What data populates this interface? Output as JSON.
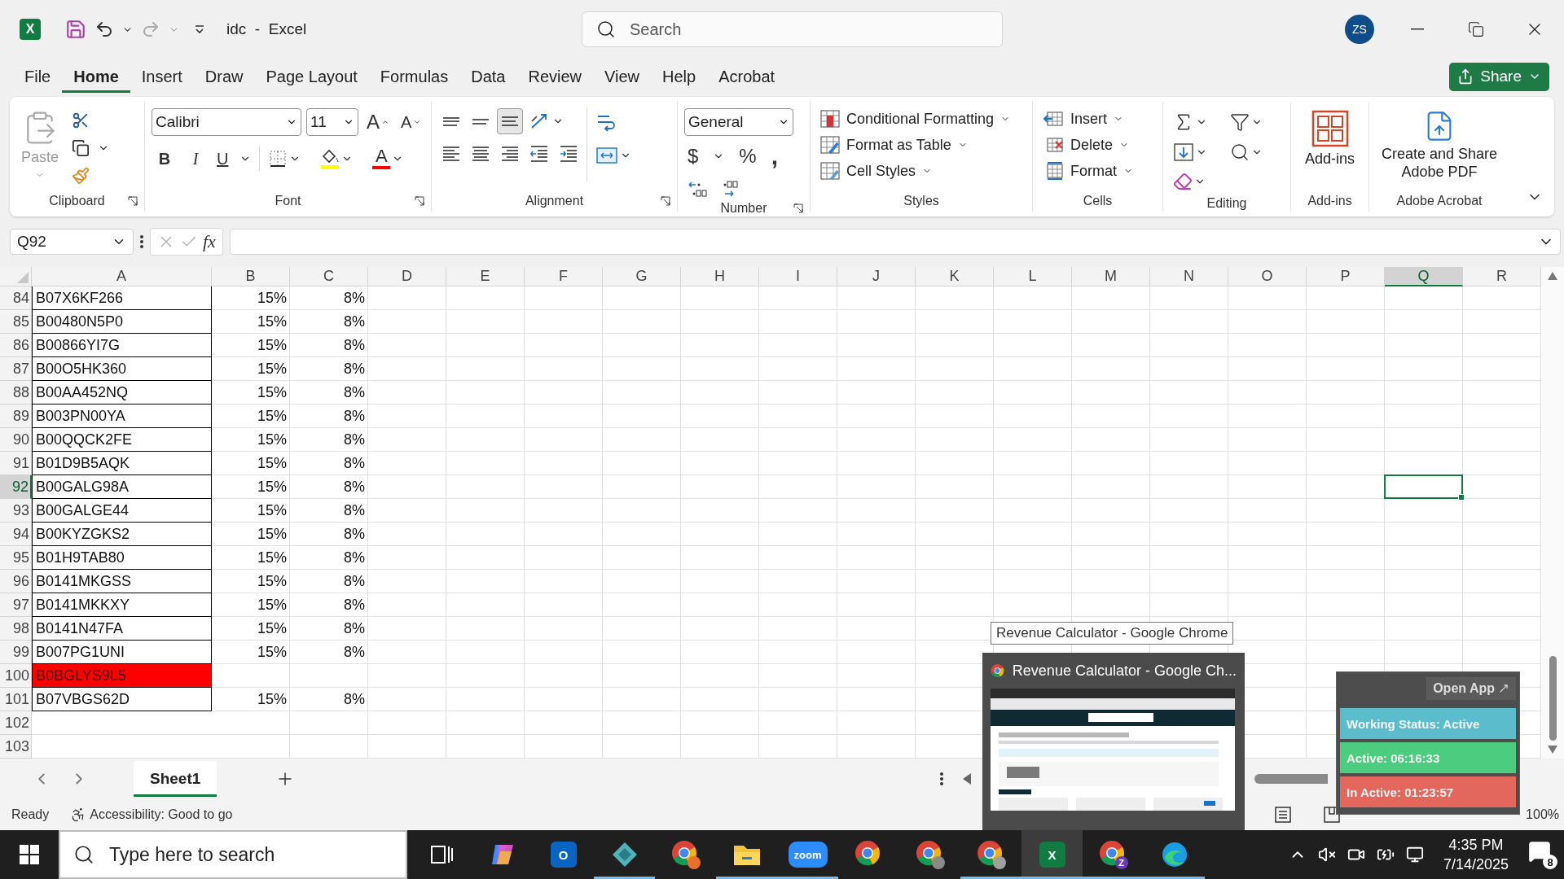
{
  "title_bar": {
    "logo": "X",
    "title": "idc  -  Excel",
    "search": {
      "placeholder": "Search"
    },
    "avatar": "ZS"
  },
  "ribbon_tabs": [
    {
      "label": "File",
      "selected": false
    },
    {
      "label": "Home",
      "selected": true
    },
    {
      "label": "Insert",
      "selected": false
    },
    {
      "label": "Draw",
      "selected": false
    },
    {
      "label": "Page Layout",
      "selected": false
    },
    {
      "label": "Formulas",
      "selected": false
    },
    {
      "label": "Data",
      "selected": false
    },
    {
      "label": "Review",
      "selected": false
    },
    {
      "label": "View",
      "selected": false
    },
    {
      "label": "Help",
      "selected": false
    },
    {
      "label": "Acrobat",
      "selected": false
    }
  ],
  "share_button": {
    "label": "Share"
  },
  "ribbon": {
    "clipboard": {
      "paste": {
        "label": "Paste",
        "disabled": true
      },
      "group": "Clipboard"
    },
    "font": {
      "name": "Calibri",
      "size": "11",
      "grow": "A",
      "shrink": "A",
      "bold": "B",
      "italic": "I",
      "underline": "U",
      "font_color": "A",
      "group": "Font"
    },
    "alignment": {
      "vertical": [
        {
          "kind": "top",
          "selected": false
        },
        {
          "kind": "middle",
          "selected": false
        },
        {
          "kind": "bottom",
          "selected": true
        }
      ],
      "group": "Alignment"
    },
    "number": {
      "format": "General",
      "currency": "$",
      "percent": "%",
      "comma": ",",
      "group": "Number"
    },
    "styles": {
      "items": [
        {
          "kind": "conditional",
          "label": "Conditional Formatting"
        },
        {
          "kind": "table",
          "label": "Format as Table"
        },
        {
          "kind": "cell",
          "label": "Cell Styles"
        }
      ],
      "group": "Styles"
    },
    "cells": {
      "items": [
        {
          "kind": "insert",
          "label": "Insert"
        },
        {
          "kind": "delete",
          "label": "Delete"
        },
        {
          "kind": "format",
          "label": "Format"
        }
      ],
      "group": "Cells"
    },
    "editing": {
      "group": "Editing"
    },
    "addins": {
      "label": "Add-ins",
      "group": "Add-ins"
    },
    "acrobat": {
      "label": "Create and Share Adobe PDF",
      "group": "Adobe Acrobat"
    }
  },
  "formula_bar": {
    "name_box": "Q92",
    "function_label": "fx"
  },
  "sheet": {
    "columns": [
      {
        "label": "A",
        "selected": false
      },
      {
        "label": "B",
        "selected": false
      },
      {
        "label": "C",
        "selected": false
      },
      {
        "label": "D",
        "selected": false
      },
      {
        "label": "E",
        "selected": false
      },
      {
        "label": "F",
        "selected": false
      },
      {
        "label": "G",
        "selected": false
      },
      {
        "label": "H",
        "selected": false
      },
      {
        "label": "I",
        "selected": false
      },
      {
        "label": "J",
        "selected": false
      },
      {
        "label": "K",
        "selected": false
      },
      {
        "label": "L",
        "selected": false
      },
      {
        "label": "M",
        "selected": false
      },
      {
        "label": "N",
        "selected": false
      },
      {
        "label": "O",
        "selected": false
      },
      {
        "label": "P",
        "selected": false
      },
      {
        "label": "Q",
        "selected": true
      },
      {
        "label": "R",
        "selected": false
      }
    ],
    "rows": [
      {
        "number": "84",
        "cells": [
          "B07X6KF266",
          "15%",
          "8%"
        ],
        "selected": false
      },
      {
        "number": "85",
        "cells": [
          "B00480N5P0",
          "15%",
          "8%"
        ],
        "selected": false
      },
      {
        "number": "86",
        "cells": [
          "B00866YI7G",
          "15%",
          "8%"
        ],
        "selected": false
      },
      {
        "number": "87",
        "cells": [
          "B00O5HK360",
          "15%",
          "8%"
        ],
        "selected": false
      },
      {
        "number": "88",
        "cells": [
          "B00AA452NQ",
          "15%",
          "8%"
        ],
        "selected": false
      },
      {
        "number": "89",
        "cells": [
          "B003PN00YA",
          "15%",
          "8%"
        ],
        "selected": false
      },
      {
        "number": "90",
        "cells": [
          "B00QQCK2FE",
          "15%",
          "8%"
        ],
        "selected": false
      },
      {
        "number": "91",
        "cells": [
          "B01D9B5AQK",
          "15%",
          "8%"
        ],
        "selected": false
      },
      {
        "number": "92",
        "cells": [
          "B00GALG98A",
          "15%",
          "8%"
        ],
        "selected": true
      },
      {
        "number": "93",
        "cells": [
          "B00GALGE44",
          "15%",
          "8%"
        ],
        "selected": false
      },
      {
        "number": "94",
        "cells": [
          "B00KYZGKS2",
          "15%",
          "8%"
        ],
        "selected": false
      },
      {
        "number": "95",
        "cells": [
          "B01H9TAB80",
          "15%",
          "8%"
        ],
        "selected": false
      },
      {
        "number": "96",
        "cells": [
          "B0141MKGSS",
          "15%",
          "8%"
        ],
        "selected": false
      },
      {
        "number": "97",
        "cells": [
          "B0141MKKXY",
          "15%",
          "8%"
        ],
        "selected": false
      },
      {
        "number": "98",
        "cells": [
          "B0141N47FA",
          "15%",
          "8%"
        ],
        "selected": false
      },
      {
        "number": "99",
        "cells": [
          "B007PG1UNI",
          "15%",
          "8%"
        ],
        "selected": false
      },
      {
        "number": "100",
        "cells": [
          "B0BGLYS9L5"
        ],
        "selected": false,
        "color": "#ff0000"
      },
      {
        "number": "101",
        "cells": [
          "B07VBGS62D",
          "15%",
          "8%"
        ],
        "selected": false
      },
      {
        "number": "102",
        "selected": false
      },
      {
        "number": "103",
        "selected": false
      }
    ]
  },
  "sheet_tabs": [
    {
      "label": "Sheet1",
      "selected": true
    }
  ],
  "status_bar": {
    "status": "Ready",
    "accessibility": "Accessibility: Good to go",
    "zoom": "100%"
  },
  "tooltip": {
    "text": "Revenue Calculator - Google Chrome"
  },
  "window_preview": {
    "title": "Revenue Calculator - Google Ch..."
  },
  "time_tracker": {
    "open_button": "Open App",
    "statuses": [
      {
        "label": "Working Status: Active",
        "color": "#5bbdcb"
      },
      {
        "label": "Active: 06:16:33",
        "color": "#4ccc7e"
      },
      {
        "label": "In Active: 01:23:57",
        "color": "#e4675d"
      }
    ]
  },
  "taskbar": {
    "search": {
      "placeholder": "Type here to search"
    },
    "apps": [
      {
        "kind": "task-view",
        "running": false,
        "active": false
      },
      {
        "kind": "copilot",
        "running": false,
        "active": false
      },
      {
        "kind": "mail",
        "mark": "O",
        "running": false,
        "active": false
      },
      {
        "kind": "gem",
        "running": true,
        "active": false
      },
      {
        "kind": "browser",
        "color": "#e8702a",
        "running": false,
        "active": false
      },
      {
        "kind": "folder",
        "running": true,
        "active": false
      },
      {
        "kind": "video",
        "mark": "zoom",
        "running": true,
        "active": false
      },
      {
        "kind": "browser",
        "running": false,
        "active": false
      },
      {
        "kind": "browser",
        "color": "#8a8a8a",
        "running": false,
        "active": false
      },
      {
        "kind": "browser",
        "color": "#a0a0a0",
        "running": true,
        "active": false
      },
      {
        "kind": "spreadsheet",
        "mark": "X",
        "running": true,
        "active": true
      },
      {
        "kind": "browser",
        "color": "#6a3bb5",
        "mark": "Z",
        "running": true,
        "active": false
      },
      {
        "kind": "edge",
        "running": true,
        "active": false
      }
    ],
    "clock": {
      "time": "4:35 PM",
      "date": "7/14/2025"
    },
    "notifications": "8"
  }
}
